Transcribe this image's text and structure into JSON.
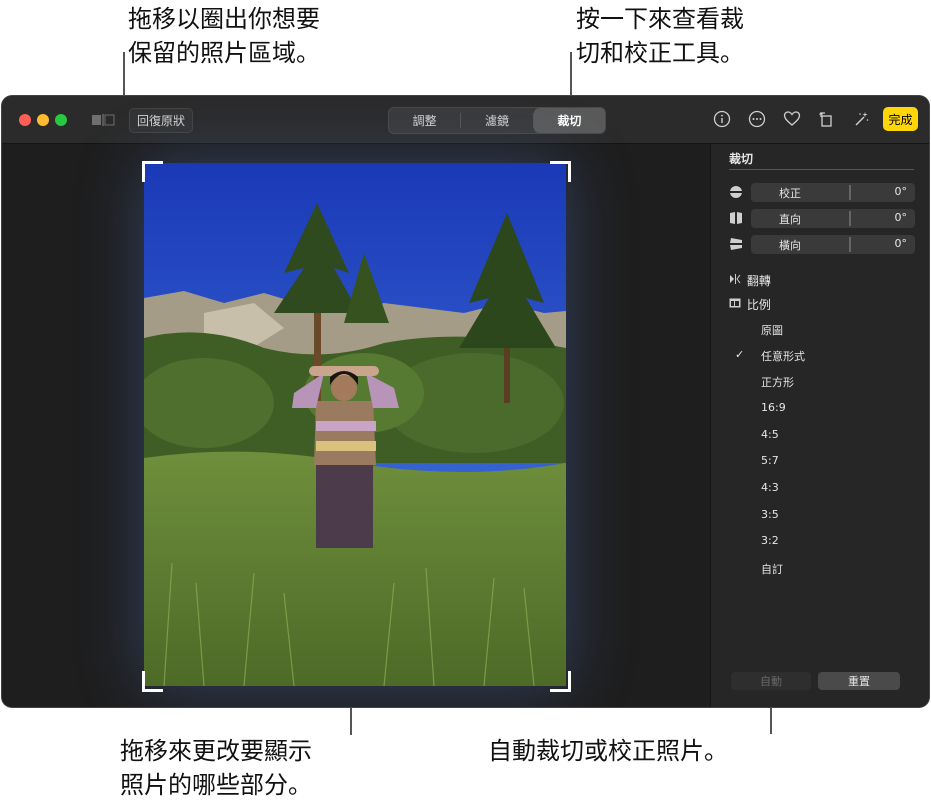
{
  "callouts": {
    "top_left": [
      "拖移以圈出你想要",
      "保留的照片區域。"
    ],
    "top_right": [
      "按一下來查看裁",
      "切和校正工具。"
    ],
    "bottom_left": [
      "拖移來更改要顯示",
      "照片的哪些部分。"
    ],
    "bottom_right": "自動裁切或校正照片。"
  },
  "toolbar": {
    "revert_label": "回復原狀",
    "tabs": [
      "調整",
      "濾鏡",
      "裁切"
    ],
    "active_tab": "裁切",
    "done_label": "完成",
    "icons": [
      "info-icon",
      "more-icon",
      "heart-icon",
      "rotate-icon",
      "auto-enhance-icon"
    ]
  },
  "sidebar": {
    "title": "裁切",
    "sliders": [
      {
        "label": "校正",
        "value": "0°",
        "icon": "straighten-icon"
      },
      {
        "label": "直向",
        "value": "0°",
        "icon": "vertical-icon"
      },
      {
        "label": "橫向",
        "value": "0°",
        "icon": "horizontal-icon"
      }
    ],
    "flip_label": "翻轉",
    "aspect_label": "比例",
    "aspect_options": [
      "原圖",
      "任意形式",
      "正方形",
      "16:9",
      "4:5",
      "5:7",
      "4:3",
      "3:5",
      "3:2",
      "自訂"
    ],
    "selected_aspect": "任意形式",
    "auto_label": "自動",
    "reset_label": "重置"
  },
  "colors": {
    "window_bg": "#1e1e1e",
    "done_yellow": "#ffd60a",
    "close_red": "#ff5f57",
    "min_yellow": "#febc2e",
    "max_green": "#28c840"
  }
}
